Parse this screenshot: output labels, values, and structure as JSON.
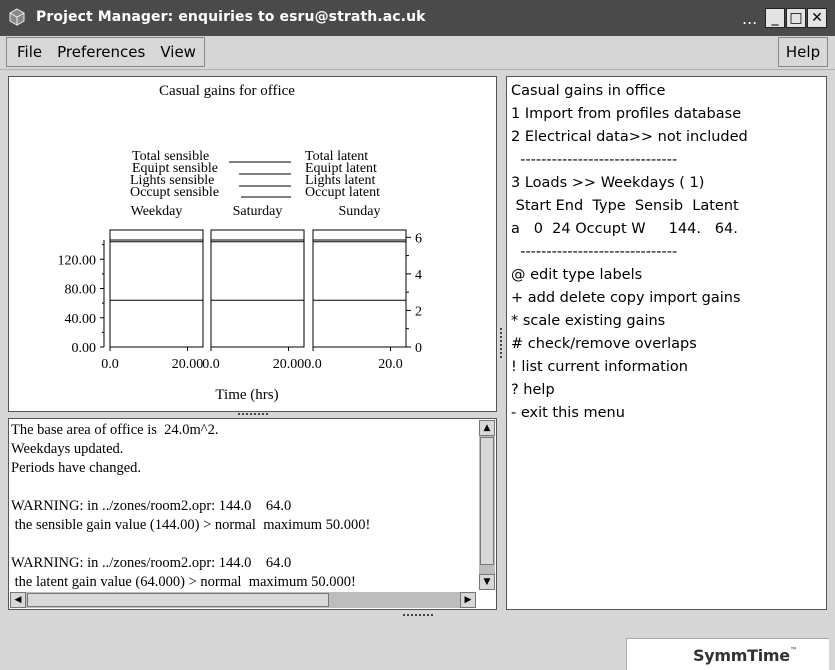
{
  "window": {
    "title": "Project Manager: enquiries to esru@strath.ac.uk",
    "controls": {
      "more": "...",
      "minimize": "_",
      "maximize": "□",
      "close": "✕"
    },
    "icon": "cube-app-icon"
  },
  "menubar": {
    "items": [
      "File",
      "Preferences",
      "View"
    ],
    "help": "Help"
  },
  "graphic": {
    "title": "Casual gains for office",
    "legend_left": [
      "Total sensible",
      "Equipt sensible",
      "Lights sensible",
      "Occupt sensible"
    ],
    "legend_right": [
      "Total latent",
      "Equipt latent",
      "Lights latent",
      "Occupt latent"
    ],
    "xlabel": "Time (hrs)"
  },
  "chart_data": {
    "type": "line",
    "title": "Casual gains for office",
    "xlabel": "Time (hrs)",
    "panels": [
      {
        "name": "Weekday",
        "x_ticks": [
          "0.0",
          "20.00"
        ]
      },
      {
        "name": "Saturday",
        "x_ticks": [
          "0.0",
          "20.00"
        ]
      },
      {
        "name": "Sunday",
        "x_ticks": [
          "0.0",
          "20.0"
        ]
      }
    ],
    "xlim": [
      0,
      24
    ],
    "left_axis": {
      "ticks": [
        "0.00",
        "40.00",
        "80.00",
        "120.00"
      ],
      "ylim": [
        0,
        160
      ]
    },
    "right_axis": {
      "ticks": [
        "0",
        "2",
        "4",
        "6"
      ],
      "ylim": [
        0,
        6.4
      ]
    },
    "series": [
      {
        "name": "Total sensible",
        "axis": "left",
        "values": [
          144,
          144,
          144
        ]
      },
      {
        "name": "Total latent",
        "axis": "left",
        "values": [
          64,
          64,
          64
        ]
      }
    ]
  },
  "console": {
    "lines": [
      "The base area of office is  24.0m^2.",
      "Weekdays updated.",
      "Periods have changed.",
      "",
      "WARNING: in ../zones/room2.opr: 144.0    64.0",
      " the sensible gain value (144.00) > normal  maximum 50.000!",
      "",
      "WARNING: in ../zones/room2.opr: 144.0    64.0",
      " the latent gain value (64.000) > normal  maximum 50.000!"
    ]
  },
  "menu_panel": {
    "lines": [
      "Casual gains in office",
      "1 Import from profiles database",
      "2 Electrical data>> not included",
      "  ------------------------------",
      "3 Loads >> Weekdays ( 1)",
      " Start End  Type  Sensib  Latent",
      "a   0  24 Occupt W     144.   64.",
      "  ------------------------------",
      "@ edit type labels",
      "+ add delete copy import gains",
      "* scale existing gains",
      "# check/remove overlaps",
      "! list current information",
      "? help",
      "- exit this menu"
    ]
  },
  "logo": {
    "text": "SymmTime",
    "tm": "™"
  }
}
